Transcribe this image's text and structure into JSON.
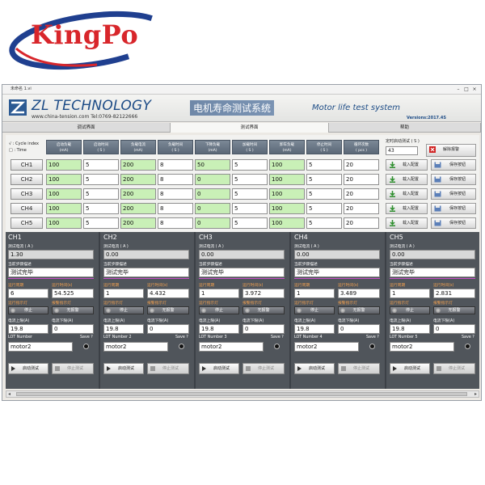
{
  "logo": {
    "text": "KingPo"
  },
  "window": {
    "title": "未命名 1.vi",
    "brand": "ZL TECHNOLOGY",
    "website": "www.china-tension.com  Tel:0769-82122666",
    "title_cn": "电机寿命测试系统",
    "title_en": "Motor life test system",
    "version": "Versions:2017.4S"
  },
  "tabs": [
    {
      "label": "调试界面",
      "active": false
    },
    {
      "label": "测试界面",
      "active": true
    },
    {
      "label": "帮助",
      "active": false
    }
  ],
  "config": {
    "cycle_index_label": "√ : Cycle index",
    "time_label": "□ : Time",
    "headers": [
      "启动负载\n(mA)",
      "启动时间\n( S )",
      "负载电流\n(mA)",
      "负载时间\n( S )",
      "下降负载\n(mA)",
      "加载时间\n( S )",
      "卸车负载\n(mA)",
      "停止时间\n( S )",
      "循环次数\n( pcs )"
    ],
    "schedule_label": "定时启动测试 ( S )",
    "schedule_value": "43",
    "alarm_button": "解除报警",
    "load_button": "载入配置",
    "save_button": "保存按钮",
    "rows": [
      {
        "channel": "CH1",
        "values": [
          "100",
          "5",
          "200",
          "8",
          "50",
          "5",
          "100",
          "5",
          "20"
        ]
      },
      {
        "channel": "CH2",
        "values": [
          "100",
          "5",
          "200",
          "8",
          "0",
          "5",
          "100",
          "5",
          "20"
        ]
      },
      {
        "channel": "CH3",
        "values": [
          "100",
          "5",
          "200",
          "8",
          "0",
          "5",
          "100",
          "5",
          "20"
        ]
      },
      {
        "channel": "CH4",
        "values": [
          "100",
          "5",
          "200",
          "8",
          "0",
          "5",
          "100",
          "5",
          "20"
        ]
      },
      {
        "channel": "CH5",
        "values": [
          "100",
          "5",
          "200",
          "8",
          "0",
          "5",
          "100",
          "5",
          "20"
        ]
      }
    ]
  },
  "labels": {
    "current": "测试电流 ( A )",
    "step_desc": "当前步骤描述",
    "run_cycle": "运行周期",
    "run_time": "运行时间(s)",
    "run_lamp": "运行指示灯",
    "alarm_lamp": "报警指示灯",
    "stop": "停止",
    "no_alarm": "无报警",
    "upper_limit": "电流上限(A)",
    "lower_limit": "电流下限(A)",
    "save": "Save ?",
    "start_button": "启动测试",
    "stop_button": "停止测试"
  },
  "channels": [
    {
      "name": "CH1",
      "current": "1.30",
      "step": "测试完毕",
      "cycle": "6",
      "time": "54.525",
      "upper": "19.8",
      "lower": "0",
      "lot_label": "LOT Number",
      "lot": "motor2"
    },
    {
      "name": "CH2",
      "current": "0.00",
      "step": "测试完毕",
      "cycle": "1",
      "time": "4.432",
      "upper": "19.8",
      "lower": "0",
      "lot_label": "LOT Number 2",
      "lot": "motor2"
    },
    {
      "name": "CH3",
      "current": "0.00",
      "step": "测试完毕",
      "cycle": "1",
      "time": "3.972",
      "upper": "19.8",
      "lower": "0",
      "lot_label": "LOT Number 3",
      "lot": "motor2"
    },
    {
      "name": "CH4",
      "current": "0.00",
      "step": "测试完毕",
      "cycle": "1",
      "time": "3.489",
      "upper": "19.8",
      "lower": "0",
      "lot_label": "LOT Number 4",
      "lot": "motor2"
    },
    {
      "name": "CH5",
      "current": "0.00",
      "step": "测试完毕",
      "cycle": "1",
      "time": "2.831",
      "upper": "19.8",
      "lower": "0",
      "lot_label": "LOT Number 5",
      "lot": "motor2"
    }
  ],
  "colors": {
    "logo_red": "#d8262b",
    "logo_blue": "#1f3f8f",
    "brand_blue": "#1c4b86",
    "cell_green": "#c9f0b7",
    "panel_dark": "#50555b",
    "label_orange": "#f0a050"
  }
}
